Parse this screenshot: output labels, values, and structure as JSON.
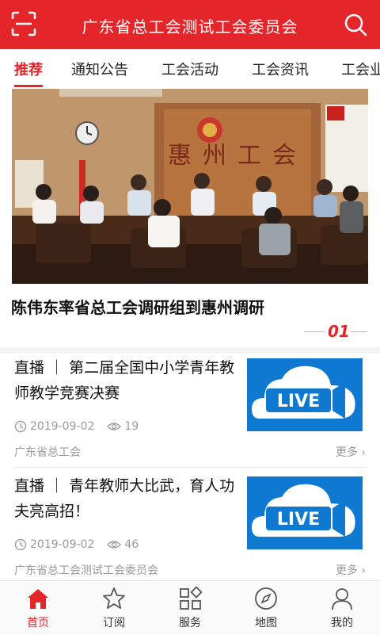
{
  "header": {
    "title": "广东省总工会测试工会委员会"
  },
  "tabs": [
    {
      "label": "推荐",
      "active": true
    },
    {
      "label": "通知公告",
      "active": false
    },
    {
      "label": "工会活动",
      "active": false
    },
    {
      "label": "工会资讯",
      "active": false
    },
    {
      "label": "工会业",
      "active": false
    }
  ],
  "hero": {
    "title": "陈伟东率省总工会调研组到惠州调研",
    "index": "01",
    "wall_sign": "惠州工会"
  },
  "articles": [
    {
      "title": "直播 ｜ 第二届全国中小学青年教师教学竞赛决赛",
      "date": "2019-09-02",
      "views": "19",
      "source": "广东省总工会",
      "more": "更多",
      "thumb_text": "LIVE"
    },
    {
      "title": "直播 ｜ 青年教师大比武，育人功夫亮高招！",
      "date": "2019-09-02",
      "views": "46",
      "source": "广东省总工会测试工会委员会",
      "more": "更多",
      "thumb_text": "LIVE"
    }
  ],
  "bottom_nav": [
    {
      "label": "首页",
      "icon": "home-icon",
      "active": true
    },
    {
      "label": "订阅",
      "icon": "star-icon",
      "active": false
    },
    {
      "label": "服务",
      "icon": "services-grid-icon",
      "active": false
    },
    {
      "label": "地图",
      "icon": "compass-icon",
      "active": false
    },
    {
      "label": "我的",
      "icon": "user-icon",
      "active": false
    }
  ],
  "colors": {
    "brand_red": "#e4252a",
    "live_blue": "#0f78d1"
  }
}
